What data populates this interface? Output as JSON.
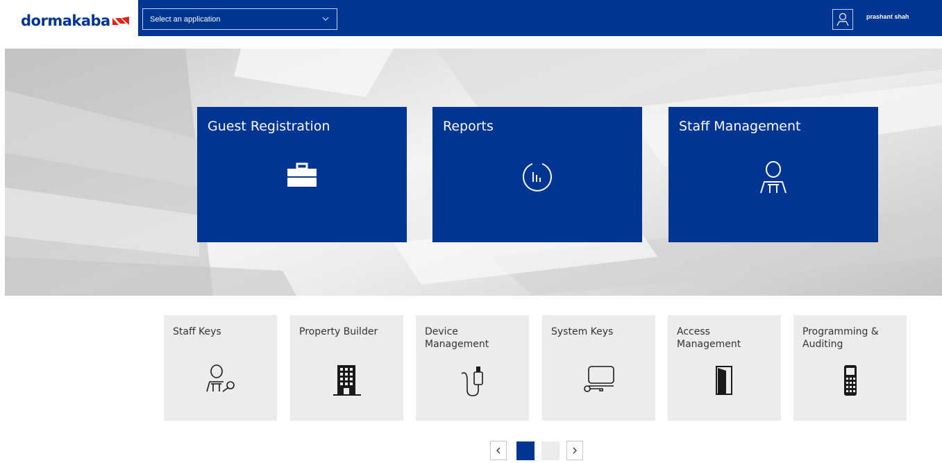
{
  "header": {
    "logo_text": "dormakaba",
    "app_select": {
      "value": "Select an application"
    },
    "user_name": "prashant shah"
  },
  "hero_tiles": [
    {
      "label": "Guest Registration",
      "icon": "briefcase-icon"
    },
    {
      "label": "Reports",
      "icon": "report-chart-icon"
    },
    {
      "label": "Staff Management",
      "icon": "staff-person-icon"
    }
  ],
  "app_tiles": [
    {
      "label": "Staff Keys",
      "icon": "staff-key-icon"
    },
    {
      "label": "Property Builder",
      "icon": "building-icon"
    },
    {
      "label": "Device Management",
      "icon": "usb-device-icon"
    },
    {
      "label": "System Keys",
      "icon": "system-key-icon"
    },
    {
      "label": "Access Management",
      "icon": "door-icon"
    },
    {
      "label": "Programming & Auditing",
      "icon": "programmer-device-icon"
    }
  ],
  "pager": {
    "current_page": 1,
    "total_pages": 2
  },
  "colors": {
    "brand": "#003594",
    "tile_bg": "#ececea",
    "logo_accent": "#e2231a"
  }
}
